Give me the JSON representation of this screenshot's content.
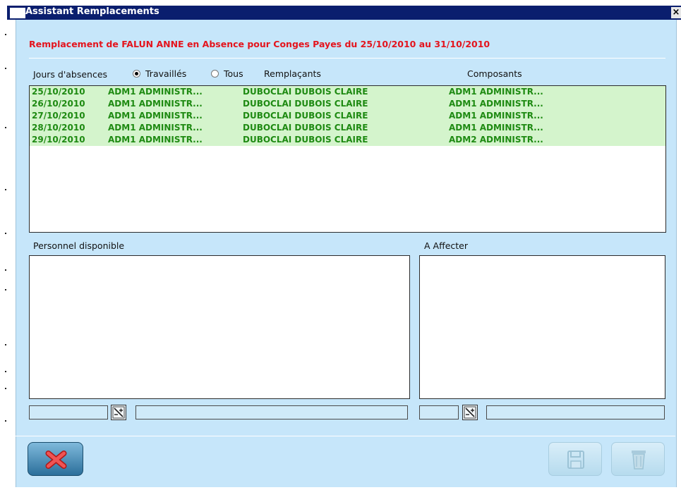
{
  "window": {
    "title": "Assistant Remplacements",
    "close_glyph": "×"
  },
  "header": {
    "message": "Remplacement de FALUN ANNE en Absence pour Conges Payes du 25/10/2010 au 31/10/2010",
    "message_color": "#e4141d"
  },
  "filters": {
    "jours_label": "Jours d'absences",
    "option_travailles": "Travaillés",
    "option_tous": "Tous",
    "selected": "Travaillés",
    "col_remplacants": "Remplaçants",
    "col_composants": "Composants"
  },
  "rows": [
    {
      "date": "25/10/2010",
      "composant": "ADM1  ADMINISTR...",
      "remplacant": "DUBOCLAI  DUBOIS CLAIRE",
      "composant2": "ADM1  ADMINISTR..."
    },
    {
      "date": "26/10/2010",
      "composant": "ADM1  ADMINISTR...",
      "remplacant": "DUBOCLAI  DUBOIS CLAIRE",
      "composant2": "ADM1  ADMINISTR..."
    },
    {
      "date": "27/10/2010",
      "composant": "ADM1  ADMINISTR...",
      "remplacant": "DUBOCLAI  DUBOIS CLAIRE",
      "composant2": "ADM1  ADMINISTR..."
    },
    {
      "date": "28/10/2010",
      "composant": "ADM1  ADMINISTR...",
      "remplacant": "DUBOCLAI  DUBOIS CLAIRE",
      "composant2": "ADM1  ADMINISTR..."
    },
    {
      "date": "29/10/2010",
      "composant": "ADM1  ADMINISTR...",
      "remplacant": "DUBOCLAI  DUBOIS CLAIRE",
      "composant2": "ADM2  ADMINISTR..."
    }
  ],
  "row_text_color": "#1e8a12",
  "row_bg_color": "#d4f4cc",
  "panels": {
    "personnel_label": "Personnel disponible",
    "affecter_label": "A Affecter"
  },
  "icons": {
    "cancel": "close-icon",
    "save": "floppy-disk-icon",
    "delete": "trash-icon",
    "search": "search-filter-icon"
  },
  "colors": {
    "window_bg": "#c6e6fa",
    "titlebar_bg": "#0a1e6e"
  }
}
